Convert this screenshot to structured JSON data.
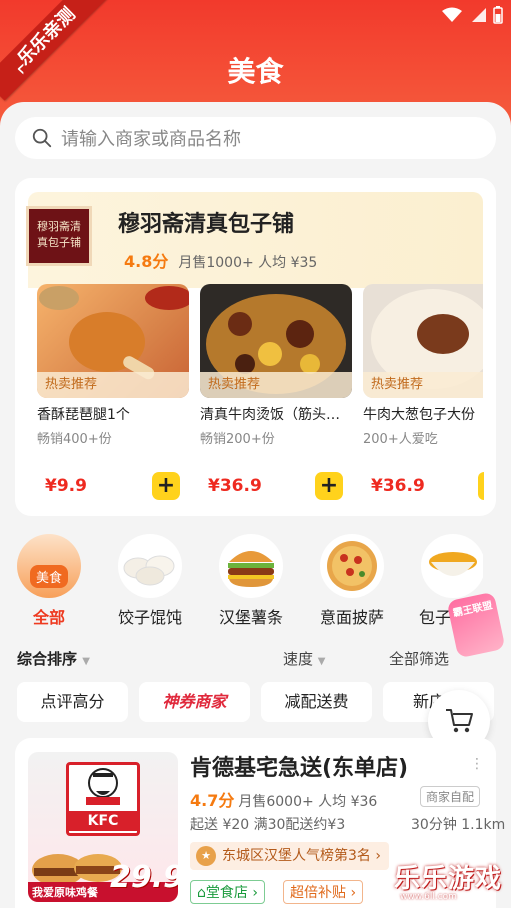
{
  "status_bar": {
    "icons": [
      "wifi-icon",
      "signal-icon",
      "battery-icon"
    ]
  },
  "watermark_ribbon": "乐乐亲测",
  "header": {
    "title": "美食"
  },
  "search": {
    "placeholder": "请输入商家或商品名称"
  },
  "featured_store": {
    "logo_text": "穆羽斋清真包子铺",
    "name": "穆羽斋清真包子铺",
    "rating": "4.8分",
    "meta": "月售1000+  人均 ¥35",
    "products": [
      {
        "tag": "热卖推荐",
        "name": "香酥琵琶腿1个",
        "sold": "畅销400+份",
        "price": "¥9.9"
      },
      {
        "tag": "热卖推荐",
        "name": "清真牛肉烫饭（筋头…",
        "sold": "畅销200+份",
        "price": "¥36.9"
      },
      {
        "tag": "热卖推荐",
        "name": "牛肉大葱包子大份",
        "sold": "200+人爱吃",
        "price": "¥36.9"
      }
    ]
  },
  "categories": [
    {
      "label": "全部",
      "badge": "美食",
      "active": true
    },
    {
      "label": "饺子馄饨"
    },
    {
      "label": "汉堡薯条"
    },
    {
      "label": "意面披萨"
    },
    {
      "label": "包子"
    }
  ],
  "sort_bar": {
    "sort": "综合排序",
    "speed": "速度",
    "filter": "全部筛选"
  },
  "filter_chips": [
    "点评高分",
    "神券商家",
    "减配送费",
    "新店"
  ],
  "restaurant": {
    "name": "肯德基宅急送(东单店)",
    "rating": "4.7分",
    "meta": "月售6000+  人均 ¥36",
    "tag": "商家自配",
    "delivery": "起送 ¥20  满30配送约¥3",
    "distance": "30分钟 1.1km",
    "rank": "东城区汉堡人气榜第3名",
    "badges": [
      "堂食店",
      "超倍补贴"
    ],
    "promo_price": "29.9",
    "promo_text": "我爱原味鸡餐",
    "brand": "KFC"
  },
  "float_ad": "霸王联盟",
  "site_watermark": {
    "title": "乐乐游戏",
    "url": "www.6ll.com"
  },
  "colors": {
    "accent": "#f23a2c",
    "price": "#ee2a20",
    "rating": "#f57a10",
    "add_button": "#ffd21c"
  }
}
